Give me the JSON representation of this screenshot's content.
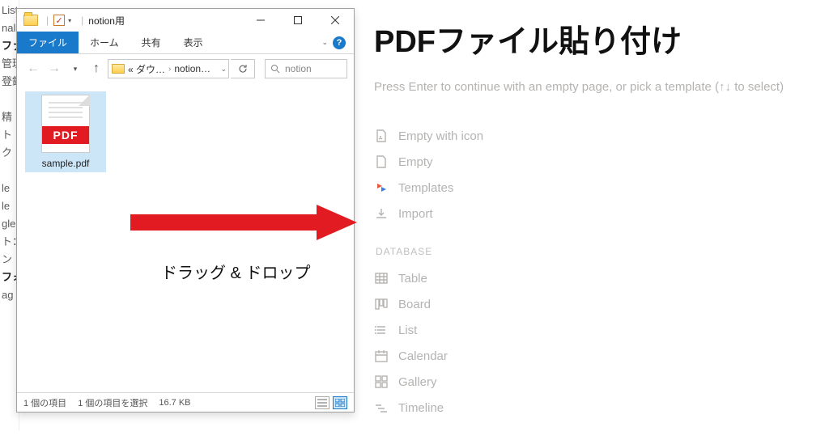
{
  "sidebar_fragments": [
    "List",
    "nal",
    "ファイル",
    "管理",
    "登録",
    "",
    "精",
    "ト",
    "ク",
    "",
    "le",
    "le",
    "gle",
    "ト：",
    "ン",
    "フォ",
    "ag",
    ""
  ],
  "explorer": {
    "window_title": "notion用",
    "tabs": {
      "file": "ファイル",
      "home": "ホーム",
      "share": "共有",
      "view": "表示"
    },
    "address": {
      "p1": "« ダウ…",
      "p2": "notion…"
    },
    "search_placeholder": "notion",
    "file": {
      "name": "sample.pdf",
      "badge": "PDF"
    },
    "dragdrop": "ドラッグ & ドロップ",
    "status": {
      "count": "1 個の項目",
      "selection": "1 個の項目を選択",
      "size": "16.7 KB"
    }
  },
  "notion": {
    "title": "PDFファイル貼り付け",
    "hint": "Press Enter to continue with an empty page, or pick a template (↑↓ to select)",
    "templates": [
      {
        "id": "empty-with-icon",
        "label": "Empty with icon"
      },
      {
        "id": "empty",
        "label": "Empty"
      },
      {
        "id": "templates",
        "label": "Templates"
      },
      {
        "id": "import",
        "label": "Import"
      }
    ],
    "database_heading": "DATABASE",
    "databases": [
      {
        "id": "table",
        "label": "Table"
      },
      {
        "id": "board",
        "label": "Board"
      },
      {
        "id": "list",
        "label": "List"
      },
      {
        "id": "calendar",
        "label": "Calendar"
      },
      {
        "id": "gallery",
        "label": "Gallery"
      },
      {
        "id": "timeline",
        "label": "Timeline"
      }
    ]
  }
}
